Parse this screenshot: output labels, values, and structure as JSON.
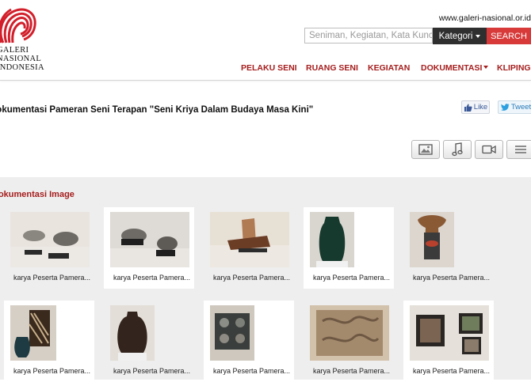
{
  "site": {
    "logo_lines": [
      "GALERI",
      "NASIONAL",
      "INDONESIA"
    ],
    "url": "www.galeri-nasional.or.id"
  },
  "search": {
    "placeholder": "Seniman, Kegiatan, Kata Kunci",
    "category_label": "Kategori",
    "button_label": "SEARCH"
  },
  "nav": {
    "items": [
      "PELAKU SENI",
      "RUANG SENI",
      "KEGIATAN",
      "DOKUMENTASI",
      "KLIPING"
    ]
  },
  "page": {
    "title": "Dokumentasi Pameran Seni Terapan \"Seni Kriya Dalam Budaya Masa Kini\""
  },
  "social": {
    "like_label": "Like",
    "tweet_label": "Tweet"
  },
  "media_tabs": [
    "image-icon",
    "music-icon",
    "video-icon",
    "list-icon"
  ],
  "gallery": {
    "heading": "Dokumentasi Image",
    "items": [
      {
        "caption": "karya Peserta Pamera..."
      },
      {
        "caption": "karya Peserta Pamera..."
      },
      {
        "caption": "karya Peserta Pamera..."
      },
      {
        "caption": "karya Peserta Pamera..."
      },
      {
        "caption": "karya Peserta Pamera..."
      },
      {
        "caption": "karya Peserta Pamera..."
      },
      {
        "caption": "karya Peserta Pamera..."
      },
      {
        "caption": "karya Peserta Pamera..."
      },
      {
        "caption": "karya Peserta Pamera..."
      },
      {
        "caption": "karya Peserta Pamera..."
      }
    ]
  },
  "colors": {
    "brand_red": "#a51d1d",
    "search_red": "#d83a3a",
    "dark": "#2f2f2f",
    "gallery_bg": "#eeeeee"
  }
}
